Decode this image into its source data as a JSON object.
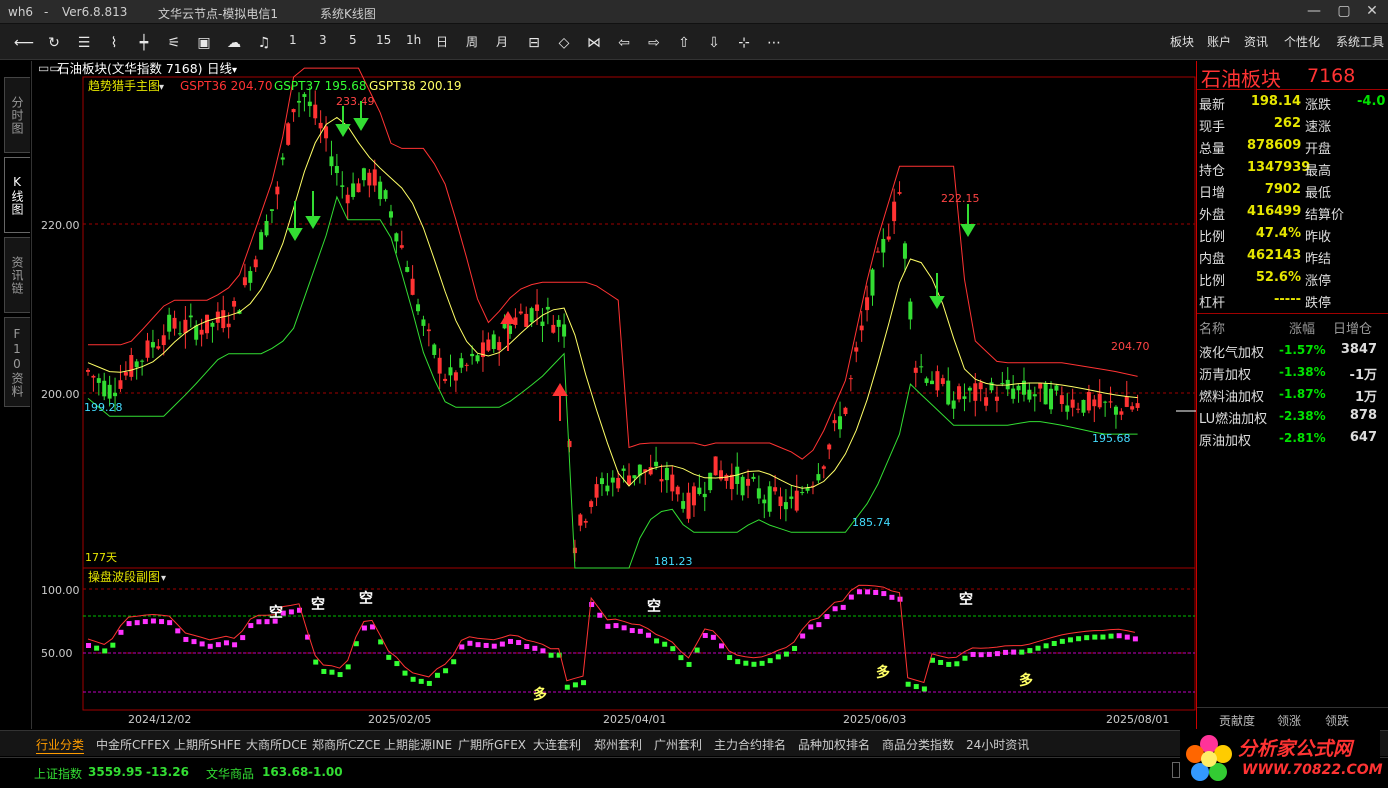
{
  "titlebar": {
    "user": "wh6",
    "sep": "-",
    "version": "Ver6.8.813",
    "server": "文华云节点-模拟电信1",
    "module": "系统K线图"
  },
  "toolbar": {
    "icons": [
      "back-icon",
      "refresh-icon",
      "list-icon",
      "line-chart-icon",
      "bar-chart-icon",
      "ruler-icon",
      "kline-icon",
      "cloud-icon",
      "bell-icon"
    ],
    "periods": [
      "1",
      "3",
      "5",
      "15",
      "1h",
      "日",
      "周",
      "月"
    ],
    "icons2": [
      "select-icon",
      "zoom-in-icon",
      "zoom-out-icon",
      "left-icon",
      "right-icon",
      "up-icon",
      "down-icon",
      "cross-icon",
      "more-icon"
    ],
    "menu": [
      "板块",
      "账户",
      "资讯",
      "个性化",
      "系统工具"
    ]
  },
  "lefttabs": [
    "分时图",
    "K线图",
    "资讯链",
    "F10资料"
  ],
  "chart": {
    "header": "石油板块(文华指数 7168)",
    "period": "日线",
    "indicator": "趋势猎手主图",
    "gsp36": "GSPT36 204.70",
    "gsp37": "GSPT37 195.68",
    "gsp38": "GSPT38 200.19",
    "days": "177天",
    "sub_indicator": "操盘波段副图",
    "price_labels": [
      "233.49",
      "222.15",
      "204.70",
      "199.28",
      "195.68",
      "185.74",
      "181.23"
    ],
    "y_ticks": [
      "220.00",
      "200.00"
    ],
    "sub_ticks": [
      "100.00",
      "50.00"
    ],
    "dates": [
      "2024/12/02",
      "2025/02/05",
      "2025/04/01",
      "2025/06/03",
      "2025/08/01"
    ],
    "markers": [
      "空",
      "空",
      "空",
      "空",
      "空",
      "多",
      "多",
      "多"
    ]
  },
  "chart_data": {
    "type": "candlestick",
    "series": [
      {
        "name": "GSPT36",
        "value": 204.7
      },
      {
        "name": "GSPT37",
        "value": 195.68
      },
      {
        "name": "GSPT38",
        "value": 200.19
      }
    ],
    "ylim": [
      180,
      235
    ],
    "sub_ylim": [
      0,
      100
    ],
    "high": 233.49,
    "low": 181.23
  },
  "panel": {
    "title": "石油板块",
    "code": "7168",
    "rows": [
      {
        "l1": "最新",
        "v1": "198.14",
        "l2": "涨跌",
        "v2": "-4.0"
      },
      {
        "l1": "现手",
        "v1": "262",
        "l2": "速涨",
        "v2": ""
      },
      {
        "l1": "总量",
        "v1": "878609",
        "l2": "开盘",
        "v2": ""
      },
      {
        "l1": "持仓",
        "v1": "1347939",
        "l2": "最高",
        "v2": ""
      },
      {
        "l1": "日增",
        "v1": "7902",
        "l2": "最低",
        "v2": ""
      },
      {
        "l1": "外盘",
        "v1": "416499",
        "l2": "结算价",
        "v2": ""
      },
      {
        "l1": "比例",
        "v1": "47.4%",
        "l2": "昨收",
        "v2": ""
      },
      {
        "l1": "内盘",
        "v1": "462143",
        "l2": "昨结",
        "v2": ""
      },
      {
        "l1": "比例",
        "v1": "52.6%",
        "l2": "涨停",
        "v2": ""
      },
      {
        "l1": "杠杆",
        "v1": "-----",
        "l2": "跌停",
        "v2": ""
      }
    ],
    "list_header": [
      "名称",
      "涨幅",
      "日增仓"
    ],
    "list": [
      {
        "n": "液化气加权",
        "c": "-1.57%",
        "d": "3847"
      },
      {
        "n": "沥青加权",
        "c": "-1.38%",
        "d": "-1万"
      },
      {
        "n": "燃料油加权",
        "c": "-1.87%",
        "d": "1万"
      },
      {
        "n": "LU燃油加权",
        "c": "-2.38%",
        "d": "878"
      },
      {
        "n": "原油加权",
        "c": "-2.81%",
        "d": "647"
      }
    ],
    "subtabs": [
      "贡献度",
      "领涨",
      "领跌"
    ]
  },
  "bottomtabs": [
    "行业分类",
    "中金所CFFEX",
    "上期所SHFE",
    "大商所DCE",
    "郑商所CZCE",
    "上期能源INE",
    "广期所GFEX",
    "大连套利",
    "郑州套利",
    "广州套利",
    "主力合约排名",
    "品种加权排名",
    "商品分类指数",
    "24小时资讯"
  ],
  "status": {
    "idx1_name": "上证指数",
    "idx1_val": "3559.95",
    "idx1_chg": "-13.26",
    "idx2_name": "文华商品",
    "idx2_val": "163.68",
    "idx2_chg": "-1.00"
  },
  "logo": {
    "title": "分析家公式网",
    "url": "WWW.70822.COM"
  }
}
